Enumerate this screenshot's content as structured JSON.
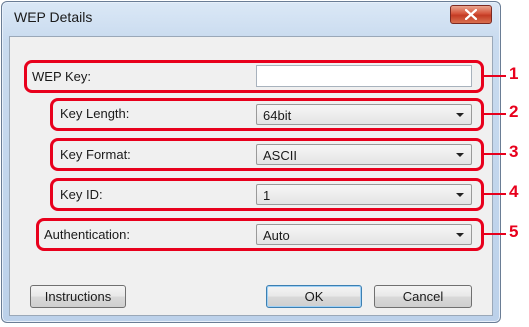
{
  "window": {
    "title": "WEP Details",
    "close_icon": "close-icon"
  },
  "fields": {
    "wep_key": {
      "label": "WEP Key:",
      "value": "",
      "callout": "1"
    },
    "key_length": {
      "label": "Key Length:",
      "value": "64bit",
      "callout": "2"
    },
    "key_format": {
      "label": "Key Format:",
      "value": "ASCII",
      "callout": "3"
    },
    "key_id": {
      "label": "Key ID:",
      "value": "1",
      "callout": "4"
    },
    "authentication": {
      "label": "Authentication:",
      "value": "Auto",
      "callout": "5"
    }
  },
  "buttons": {
    "instructions": "Instructions",
    "ok": "OK",
    "cancel": "Cancel"
  },
  "colors": {
    "callout": "#e8001c",
    "titlebar": "#bcd1ea",
    "close_button": "#c43b24"
  }
}
